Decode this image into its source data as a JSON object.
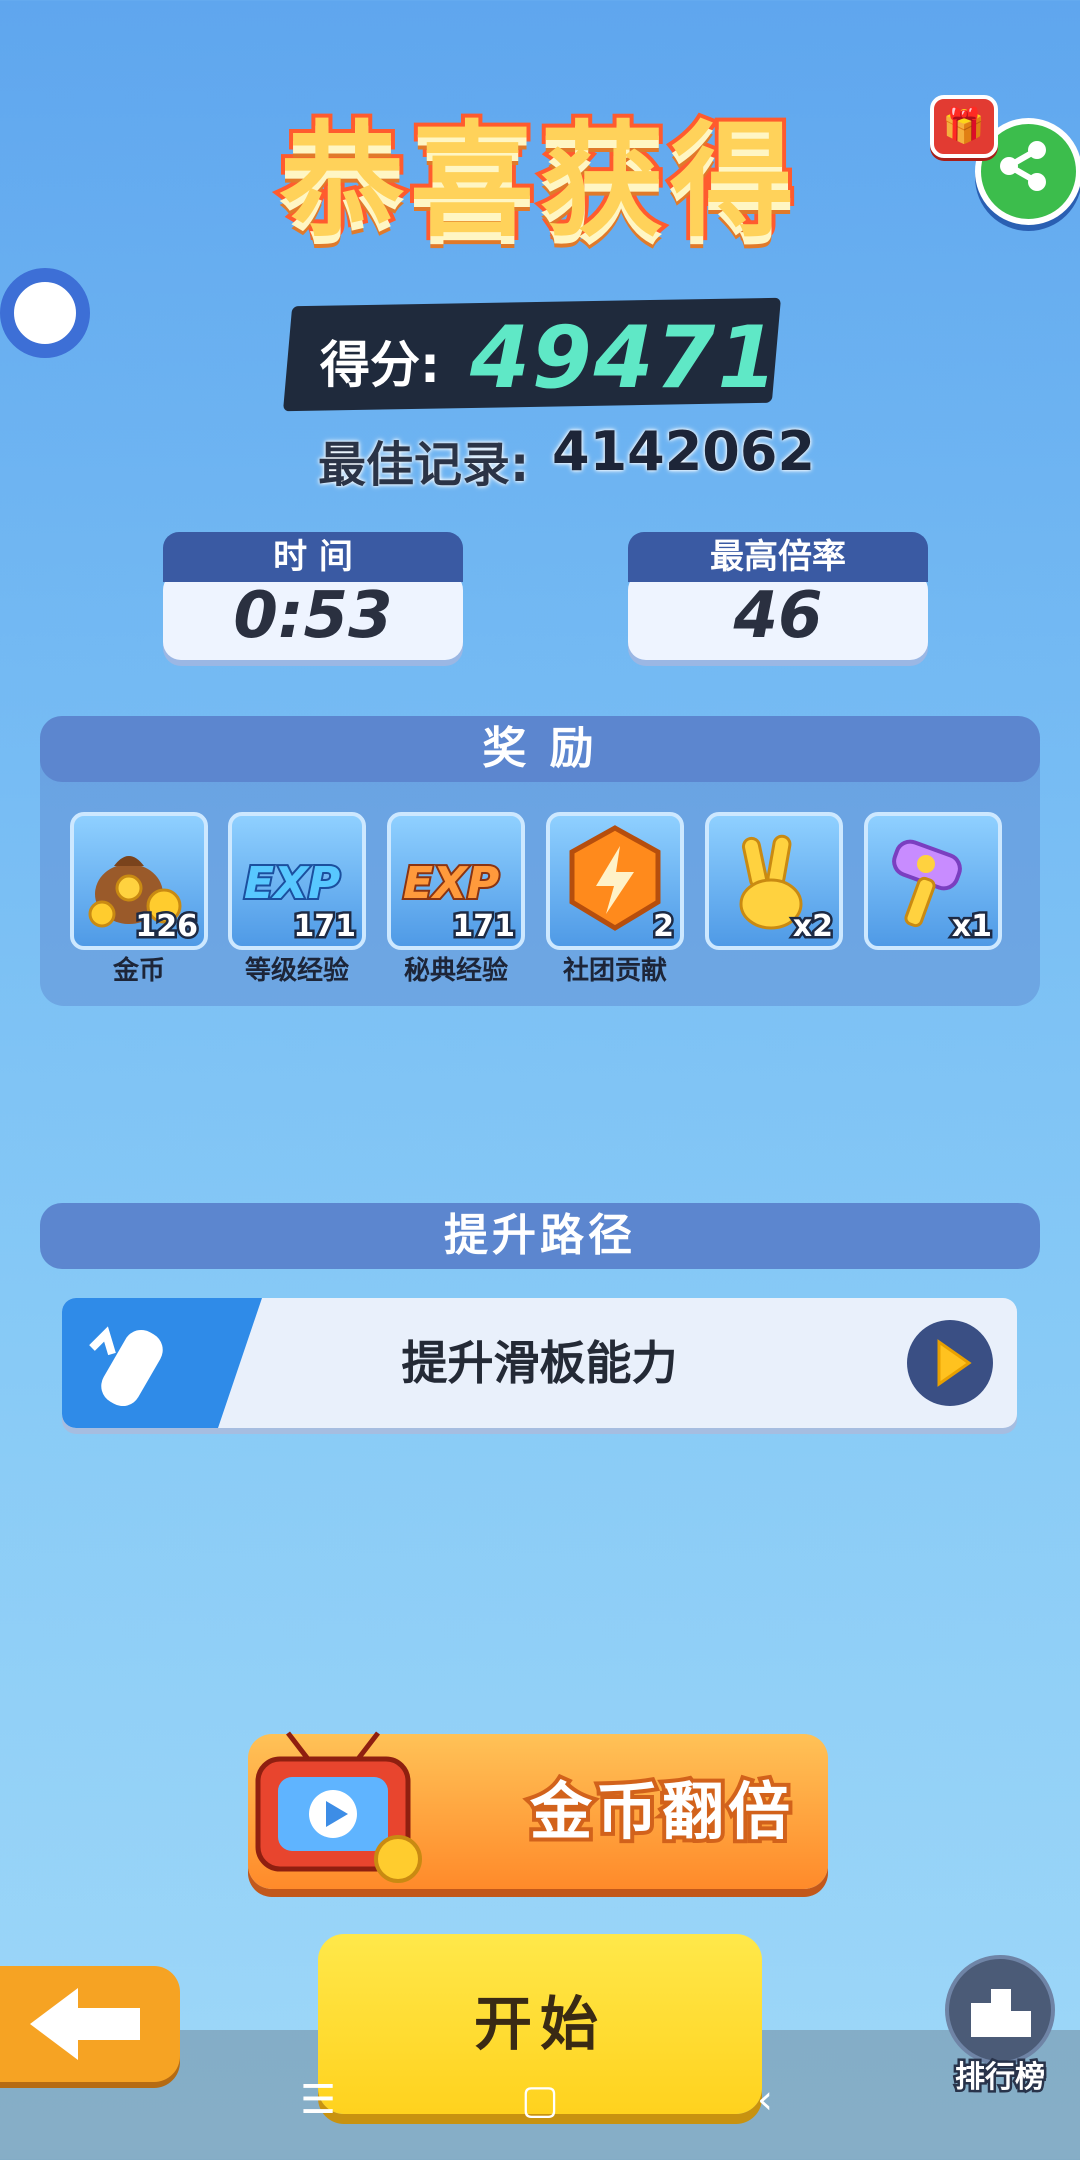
{
  "header": {
    "title": "恭喜获得"
  },
  "score": {
    "label": "得分:",
    "value": "49471"
  },
  "best": {
    "label": "最佳记录:",
    "value": "4142062"
  },
  "stats": [
    {
      "label": "时 间",
      "value": "0:53"
    },
    {
      "label": "最高倍率",
      "value": "46"
    }
  ],
  "rewards": {
    "title": "奖 励",
    "items": [
      {
        "icon": "coin-bag-icon",
        "count": "126",
        "label": "金币"
      },
      {
        "icon": "exp-blue-icon",
        "count": "171",
        "label": "等级经验"
      },
      {
        "icon": "exp-orange-icon",
        "count": "171",
        "label": "秘典经验"
      },
      {
        "icon": "lightning-badge-icon",
        "count": "2",
        "label": "社团贡献"
      },
      {
        "icon": "victory-hand-icon",
        "count": "x2",
        "label": ""
      },
      {
        "icon": "hammer-icon",
        "count": "x1",
        "label": ""
      }
    ]
  },
  "upgrade": {
    "title": "提升路径",
    "card_text": "提升滑板能力"
  },
  "buttons": {
    "double": "金币翻倍",
    "start": "开始",
    "leaderboard": "排行榜"
  },
  "colors": {
    "accent": "#ff5b2e",
    "score_value": "#5fe8c6",
    "start": "#ffd21e",
    "panel": "#5c86cf"
  }
}
